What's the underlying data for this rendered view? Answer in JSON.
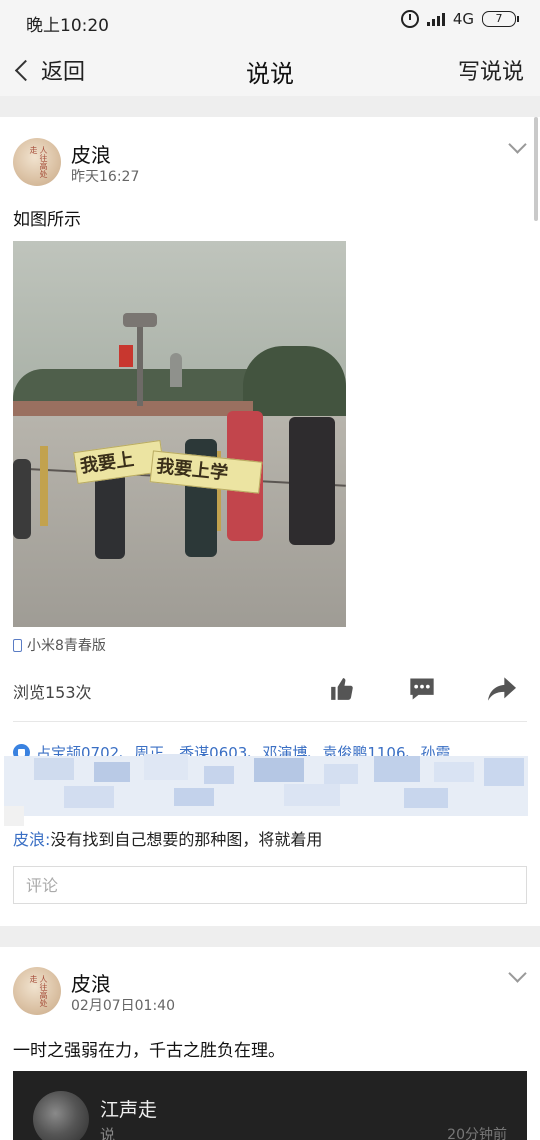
{
  "status_bar": {
    "time": "晚上10:20",
    "network": "4G",
    "battery": "7"
  },
  "nav": {
    "back_label": "返回",
    "title": "说说",
    "action_label": "写说说"
  },
  "post1": {
    "username": "皮浪",
    "time": "昨天16:27",
    "text": "如图所示",
    "photo_banner_left": "我要上",
    "photo_banner_right": "我要上学",
    "device": "小米8青春版",
    "views": "浏览153次",
    "likers_prefix": "占宝颉0702、周正、香谋0603、邓演博、袁俊鹏1106、孙霞",
    "comment": {
      "author": "皮浪:",
      "text": "没有找到自己想要的那种图，将就着用"
    },
    "comment_placeholder": "评论"
  },
  "post2": {
    "username": "皮浪",
    "time": "02月07日01:40",
    "text": "一时之强弱在力，千古之胜负在理。",
    "share": {
      "title": "江声走",
      "subtitle": "说",
      "time": "20分钟前"
    }
  },
  "avatar_seal_text": "人往高处走",
  "icons": [
    "back-chevron-icon",
    "alarm-icon",
    "signal-icon",
    "battery-icon",
    "chevron-down-icon",
    "phone-icon",
    "thumbs-up-icon",
    "comment-icon",
    "share-icon",
    "like-badge-icon"
  ],
  "colors": {
    "link_blue": "#3a6fc4",
    "like_blue": "#3a82e0",
    "action_gray": "#555555"
  }
}
